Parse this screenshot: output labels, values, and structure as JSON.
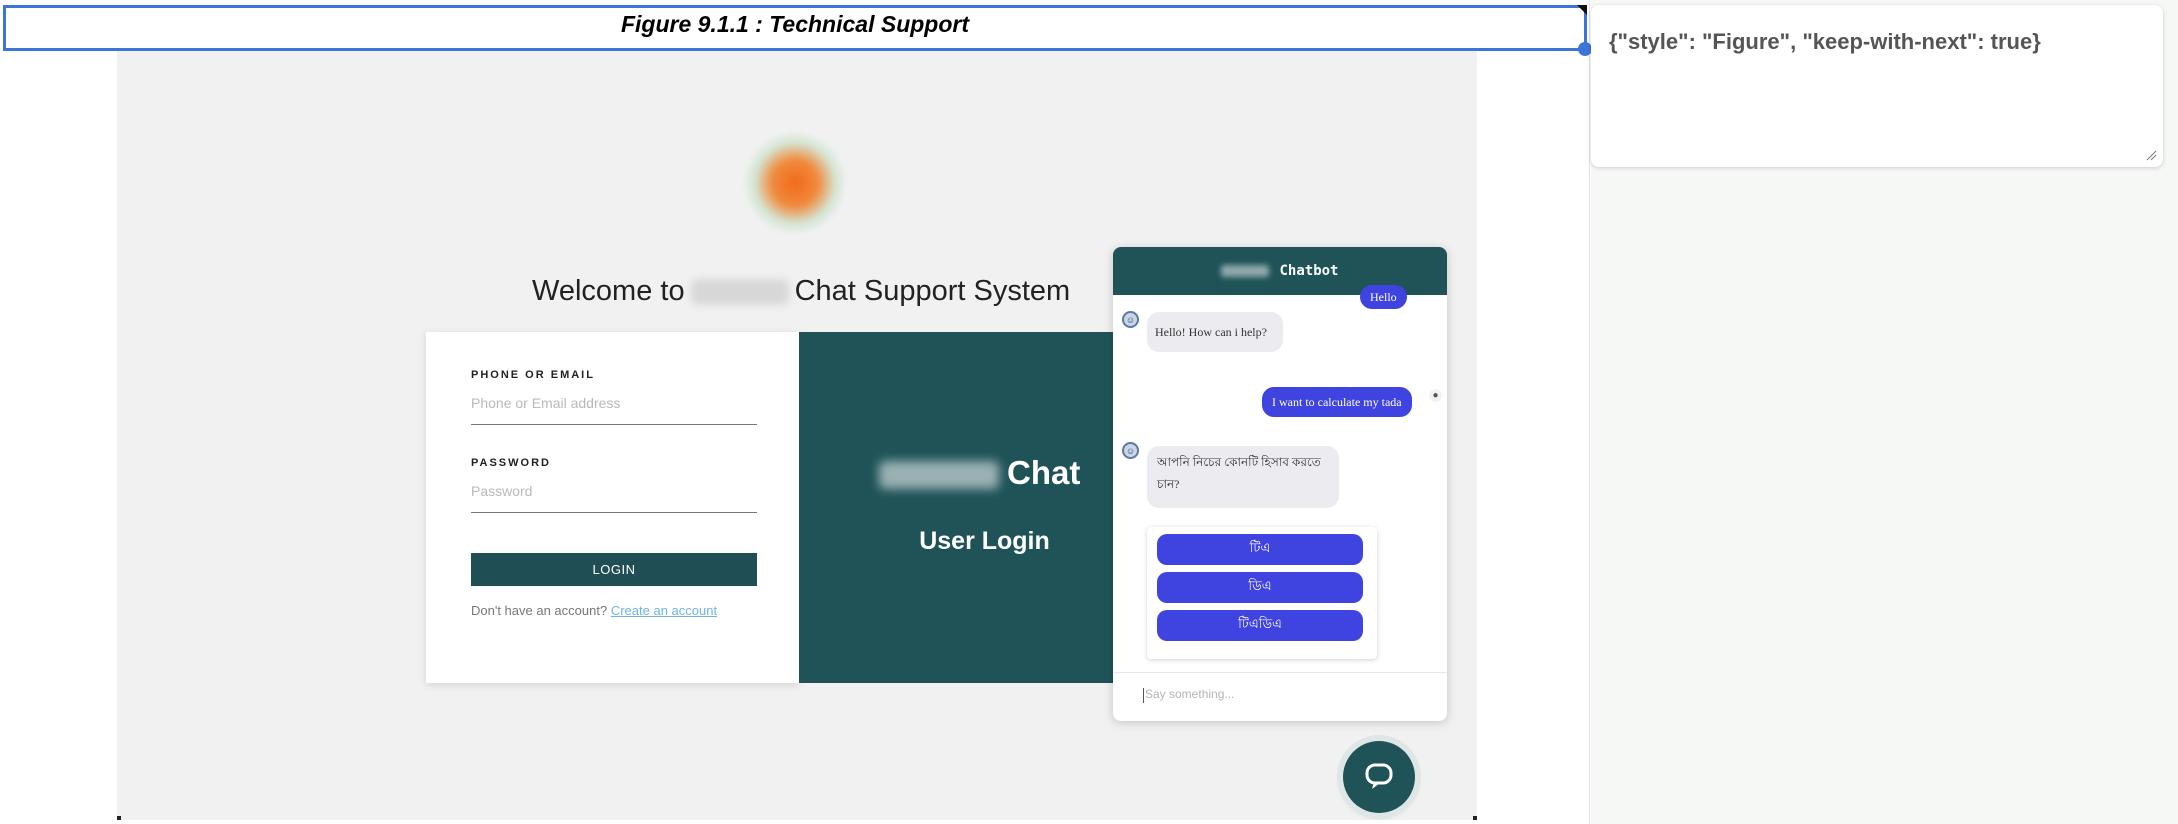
{
  "caption": "Figure 9.1.1 : Technical Support",
  "properties_panel": {
    "text": "{\"style\": \"Figure\", \"keep-with-next\": true}"
  },
  "screenshot": {
    "welcome": {
      "prefix": "Welcome to",
      "suffix": "Chat Support System"
    },
    "login": {
      "phone_label": "PHONE OR EMAIL",
      "phone_placeholder": "Phone or Email address",
      "password_label": "PASSWORD",
      "password_placeholder": "Password",
      "login_button": "LOGIN",
      "no_account_text": "Don't have an account?",
      "create_account_link": "Create an account"
    },
    "brand_panel": {
      "brand_suffix": "Chat",
      "subtitle": "User Login"
    },
    "chatbot": {
      "title_suffix": "Chatbot",
      "messages": [
        {
          "from": "user",
          "text": "Hello"
        },
        {
          "from": "bot",
          "text": "Hello! How can i help?"
        },
        {
          "from": "user",
          "text": "I want to calculate my tada"
        },
        {
          "from": "bot",
          "text": "আপনি নিচের কোনটি হিসাব করতে চান?"
        }
      ],
      "options": [
        "টিএ",
        "ডিএ",
        "টিএডিএ"
      ],
      "input_placeholder": "Say something...",
      "grammarly_badge": "G"
    },
    "colors": {
      "teal": "#1f5358",
      "bubble_blue": "#3f43e0",
      "selection_blue": "#3d74d9"
    }
  }
}
